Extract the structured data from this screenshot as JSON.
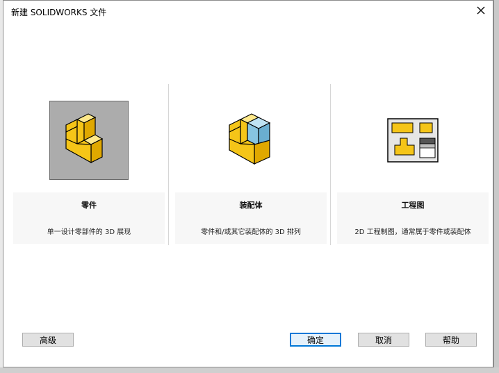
{
  "dialog": {
    "title": "新建 SOLIDWORKS 文件",
    "close_icon": "close-icon"
  },
  "templates": [
    {
      "name": "零件",
      "description": "单一设计零部件的 3D 展现",
      "icon": "part-icon",
      "selected": true
    },
    {
      "name": "装配体",
      "description": "零件和/或其它装配体的 3D 排列",
      "icon": "assembly-icon",
      "selected": false
    },
    {
      "name": "工程图",
      "description": "2D 工程制图，通常属于零件或装配体",
      "icon": "drawing-icon",
      "selected": false
    }
  ],
  "buttons": {
    "advanced": "高级",
    "ok": "确定",
    "cancel": "取消",
    "help": "帮助"
  },
  "colors": {
    "accent": "#0078d7",
    "part_yellow": "#f5c518",
    "assembly_blue": "#87c4e0",
    "selected_tile": "#acacac"
  }
}
